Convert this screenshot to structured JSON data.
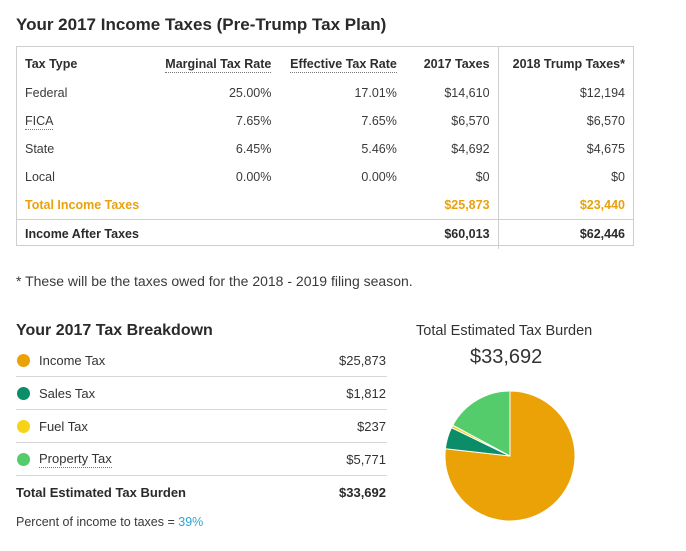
{
  "title": "Your 2017 Income Taxes (Pre-Trump Tax Plan)",
  "table": {
    "headers": {
      "type": "Tax Type",
      "marginal": "Marginal Tax Rate",
      "effective": "Effective Tax Rate",
      "taxes2017": "2017 Taxes",
      "trump2018": "2018 Trump Taxes*"
    },
    "rows": [
      {
        "type": "Federal",
        "marginal": "25.00%",
        "effective": "17.01%",
        "taxes2017": "$14,610",
        "trump2018": "$12,194"
      },
      {
        "type": "FICA",
        "marginal": "7.65%",
        "effective": "7.65%",
        "taxes2017": "$6,570",
        "trump2018": "$6,570"
      },
      {
        "type": "State",
        "marginal": "6.45%",
        "effective": "5.46%",
        "taxes2017": "$4,692",
        "trump2018": "$4,675"
      },
      {
        "type": "Local",
        "marginal": "0.00%",
        "effective": "0.00%",
        "taxes2017": "$0",
        "trump2018": "$0"
      }
    ],
    "total": {
      "label": "Total Income Taxes",
      "taxes2017": "$25,873",
      "trump2018": "$23,440"
    },
    "after": {
      "label": "Income After Taxes",
      "taxes2017": "$60,013",
      "trump2018": "$62,446"
    }
  },
  "footnote": "* These will be the taxes owed for the 2018 - 2019 filing season.",
  "breakdown": {
    "title": "Your 2017 Tax Breakdown",
    "items": [
      {
        "label": "Income Tax",
        "value": "$25,873",
        "color": "#eba206"
      },
      {
        "label": "Sales Tax",
        "value": "$1,812",
        "color": "#0a8d68"
      },
      {
        "label": "Fuel Tax",
        "value": "$237",
        "color": "#f7d316"
      },
      {
        "label": "Property Tax",
        "value": "$5,771",
        "color": "#55cc6c"
      }
    ],
    "total_label": "Total Estimated Tax Burden",
    "total_value": "$33,692",
    "percent_label": "Percent of income to taxes = ",
    "percent_value": "39%"
  },
  "pie": {
    "title": "Total Estimated Tax Burden",
    "amount": "$33,692"
  },
  "chart_data": {
    "type": "pie",
    "categories": [
      "Income Tax",
      "Sales Tax",
      "Fuel Tax",
      "Property Tax"
    ],
    "values": [
      25873,
      1812,
      237,
      5771
    ],
    "colors": [
      "#eba206",
      "#0a8d68",
      "#f7d316",
      "#55cc6c"
    ],
    "title": "Total Estimated Tax Burden"
  }
}
